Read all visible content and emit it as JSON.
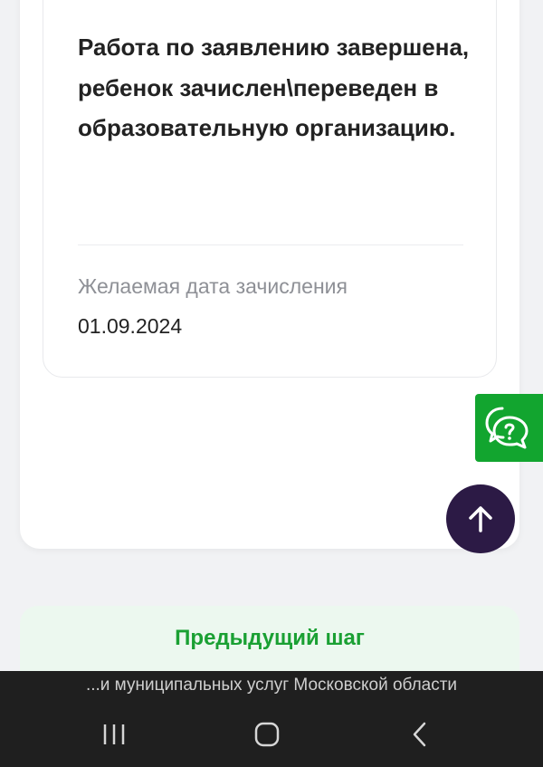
{
  "application": {
    "status_message": "Работа по заявлению завершена, ребенок зачислен\\переведен в образовательную организацию.",
    "desired_date_label": "Желаемая дата зачисления",
    "desired_date_value": "01.09.2024"
  },
  "actions": {
    "prev_step_label": "Предыдущий шаг",
    "chat_icon": "chat-help-icon",
    "scroll_top_icon": "arrow-up-icon"
  },
  "browser": {
    "title": "...и муниципальных услуг Московской области"
  },
  "system_nav": {
    "recents_icon": "recents-icon",
    "home_icon": "home-icon",
    "back_icon": "back-icon"
  },
  "colors": {
    "accent_green": "#12a52f",
    "scroll_button": "#2c1a45",
    "prev_step_bg": "#ecf8ef",
    "prev_step_text": "#1aa033",
    "nav_bar": "#1f1f1f"
  }
}
